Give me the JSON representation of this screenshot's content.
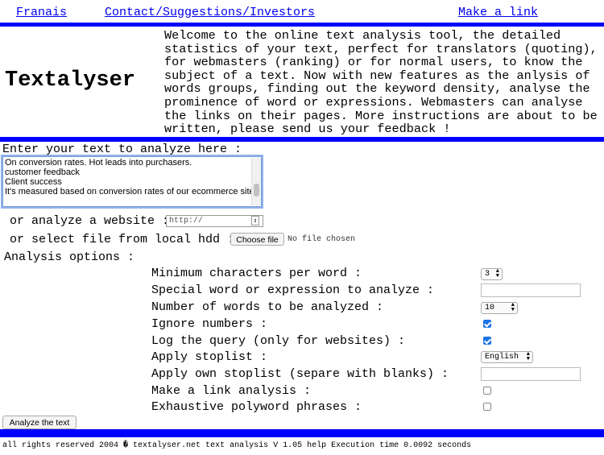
{
  "nav": {
    "francais": "Franais",
    "contact": "Contact/Suggestions/Investors",
    "make_link": "Make a link"
  },
  "header": {
    "logo": "Textalyser",
    "intro_lines": [
      "Welcome to the online text analysis tool, the detailed",
      "statistics of your text, perfect for translators (quoting),",
      "for webmasters (ranking) or for normal users, to know the",
      "subject of a text. Now with new features as the anlysis of",
      "words groups, finding out the keyword density, analyse the",
      "prominence of word or expressions. Webmasters can analyse",
      "the links on their pages. More instructions are about to be",
      "written, please send us your feedback !"
    ]
  },
  "form": {
    "enter_label": "Enter your text to analyze here :",
    "textarea_value": "On conversion rates. Hot leads into purchasers.\ncustomer feedback\nClient success\nIt's measured based on conversion rates of our ecommerce sites",
    "website_label": "or analyze a website :",
    "url_value": "http://",
    "file_label": "or select file from local hdd :",
    "choose_file": "Choose file",
    "no_file": "No file chosen",
    "options_label": "Analysis options :",
    "options": {
      "min_chars": {
        "label": "Minimum characters per word :",
        "value": "3"
      },
      "special_word": {
        "label": "Special word or expression to analyze :",
        "value": ""
      },
      "num_words": {
        "label": "Number of words to be analyzed :",
        "value": "10"
      },
      "ignore_numbers": {
        "label": "Ignore numbers :",
        "checked": true
      },
      "log_query": {
        "label": "Log the query (only for websites) :",
        "checked": true
      },
      "stoplist": {
        "label": "Apply stoplist :",
        "value": "English"
      },
      "own_stoplist": {
        "label": "Apply own stoplist (separe with blanks) :",
        "value": ""
      },
      "link_analysis": {
        "label": "Make a link analysis :",
        "checked": false
      },
      "polyword": {
        "label": "Exhaustive polyword phrases :",
        "checked": false
      }
    },
    "submit": "Analyze the text"
  },
  "footer": {
    "text": "all rights reserved 2004 � textalyser.net text analysis V 1.05 help Execution time 0.0092 seconds"
  },
  "colors": {
    "bar": "#0000ff",
    "link": "#0000ee",
    "checkbox": "#1a73e8"
  }
}
